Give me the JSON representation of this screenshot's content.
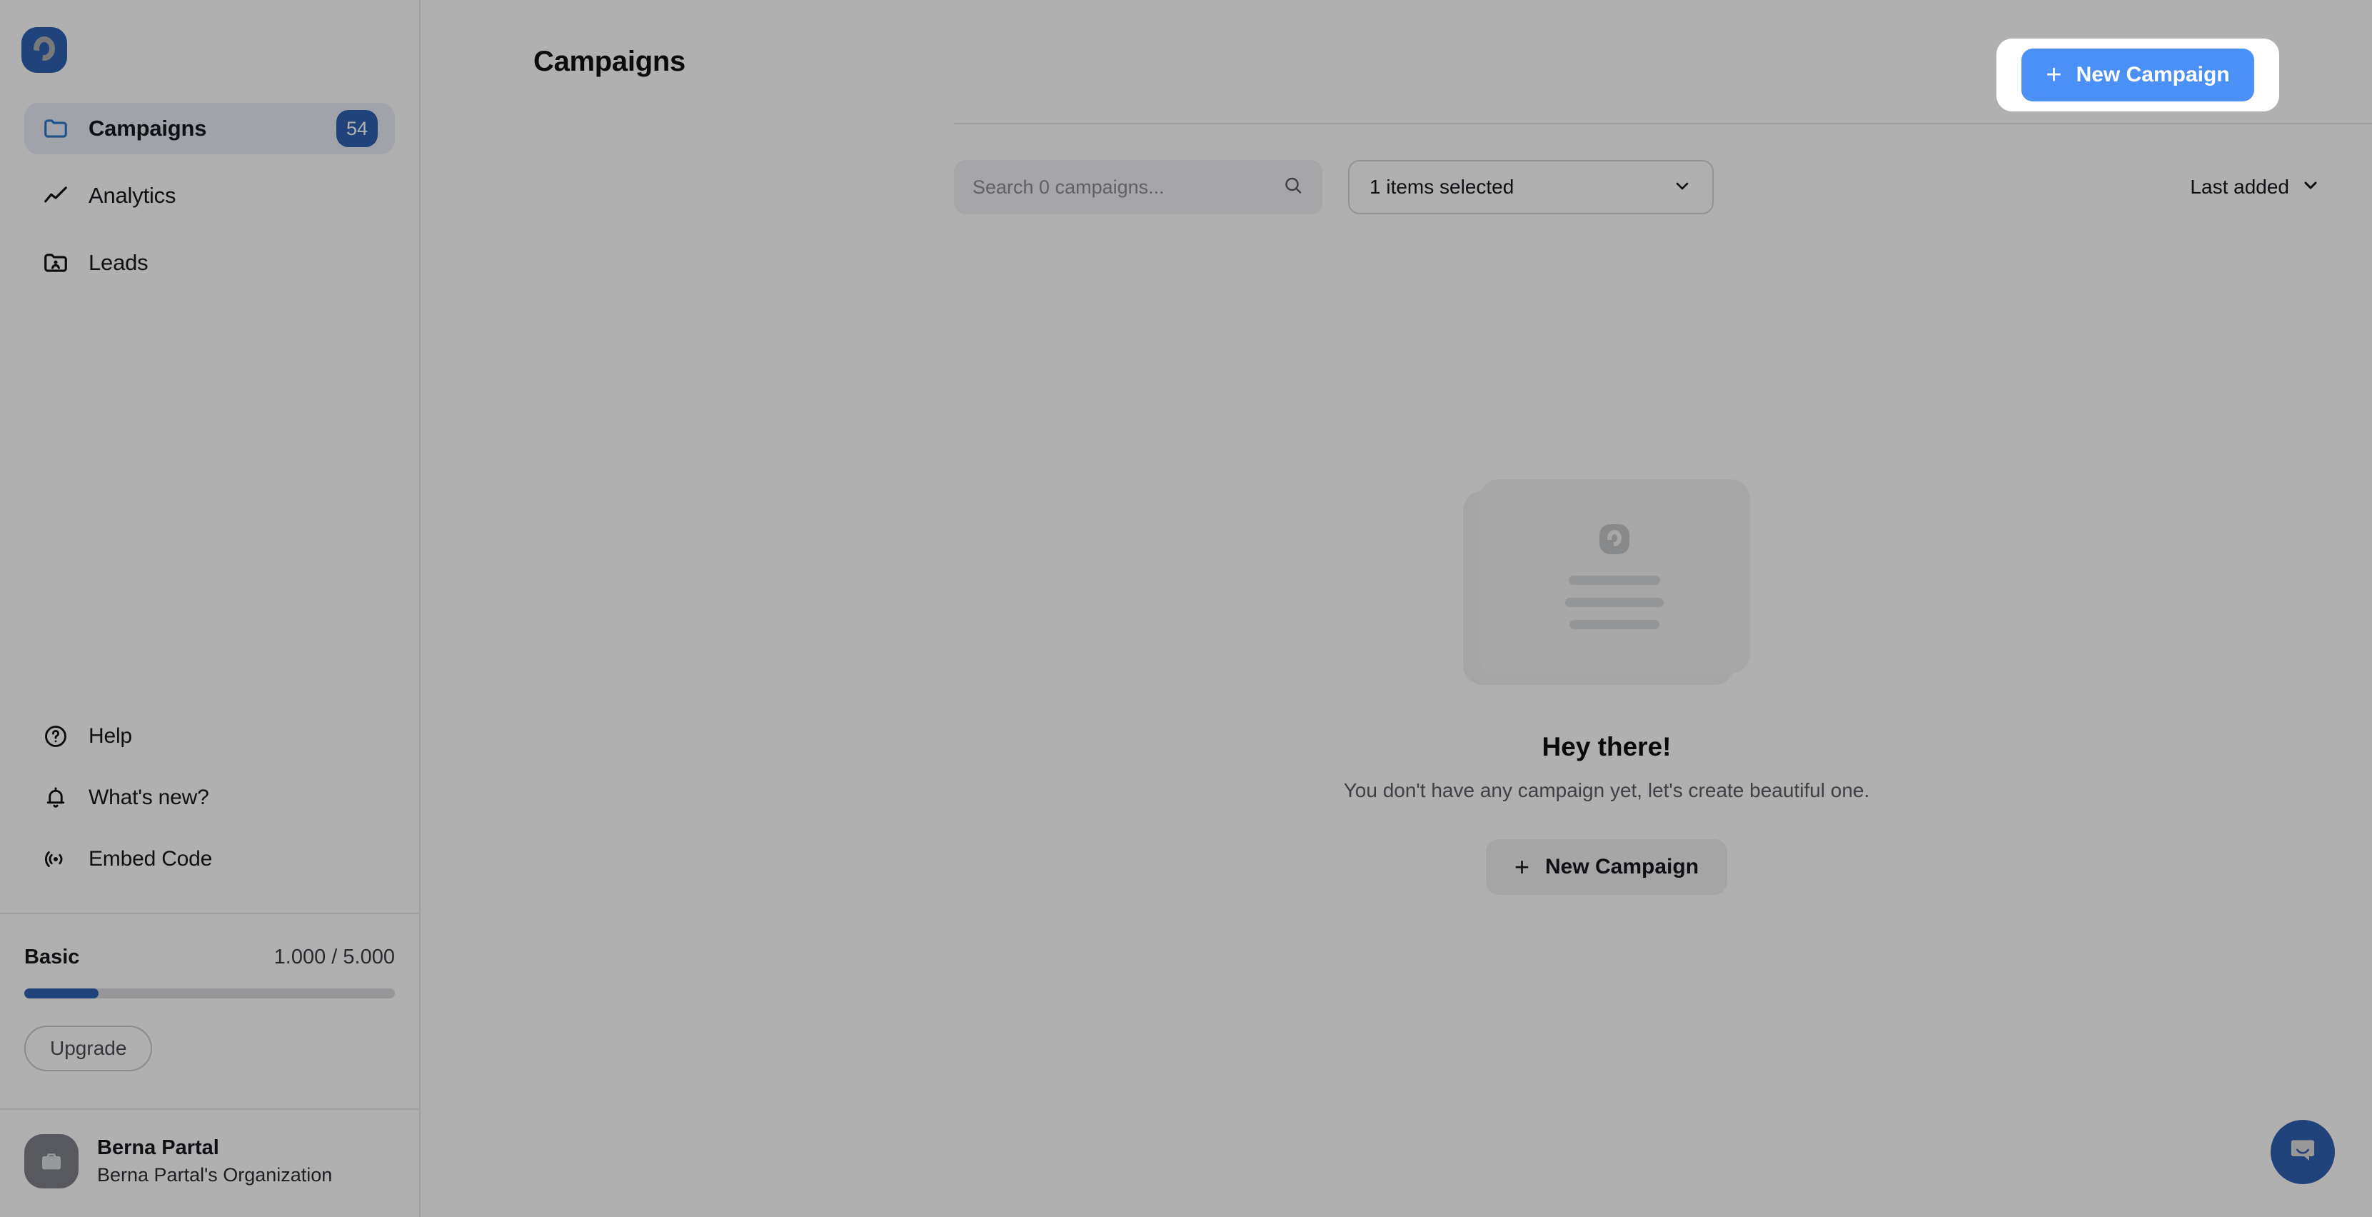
{
  "app": {
    "brand_logo_icon": "product-logo-icon",
    "accent_blue": "#2f62b3",
    "button_blue": "#4a90f7"
  },
  "sidebar": {
    "nav_items": [
      {
        "label": "Campaigns",
        "icon": "folder-icon",
        "badge": "54",
        "active": true
      },
      {
        "label": "Analytics",
        "icon": "line-chart-icon",
        "badge": "",
        "active": false
      },
      {
        "label": "Leads",
        "icon": "folder-user-icon",
        "badge": "",
        "active": false
      }
    ],
    "bottom_items": [
      {
        "label": "Help",
        "icon": "question-circle-icon"
      },
      {
        "label": "What's new?",
        "icon": "bell-icon"
      },
      {
        "label": "Embed Code",
        "icon": "broadcast-icon"
      }
    ],
    "plan": {
      "name": "Basic",
      "usage": "1.000 / 5.000",
      "progress_percent": 20,
      "upgrade_label": "Upgrade"
    },
    "user": {
      "name": "Berna Partal",
      "organization": "Berna Partal's Organization",
      "avatar_icon": "briefcase-icon"
    }
  },
  "header": {
    "title": "Campaigns",
    "new_campaign_label": "New Campaign",
    "plus_icon": "plus-icon"
  },
  "toolbar": {
    "search_placeholder": "Search 0 campaigns...",
    "search_value": "",
    "search_icon": "search-icon",
    "filter_value": "1 items selected",
    "filter_chevron_icon": "chevron-down-icon",
    "sort_value": "Last added",
    "sort_chevron_icon": "chevron-down-icon"
  },
  "empty_state": {
    "title": "Hey there!",
    "subtitle": "You don't have any campaign yet, let's create beautiful one.",
    "button_label": "New Campaign",
    "plus_icon": "plus-icon",
    "illustration_icon": "campaign-placeholder-illustration"
  },
  "widgets": {
    "intercom_icon": "chat-bubble-icon"
  }
}
